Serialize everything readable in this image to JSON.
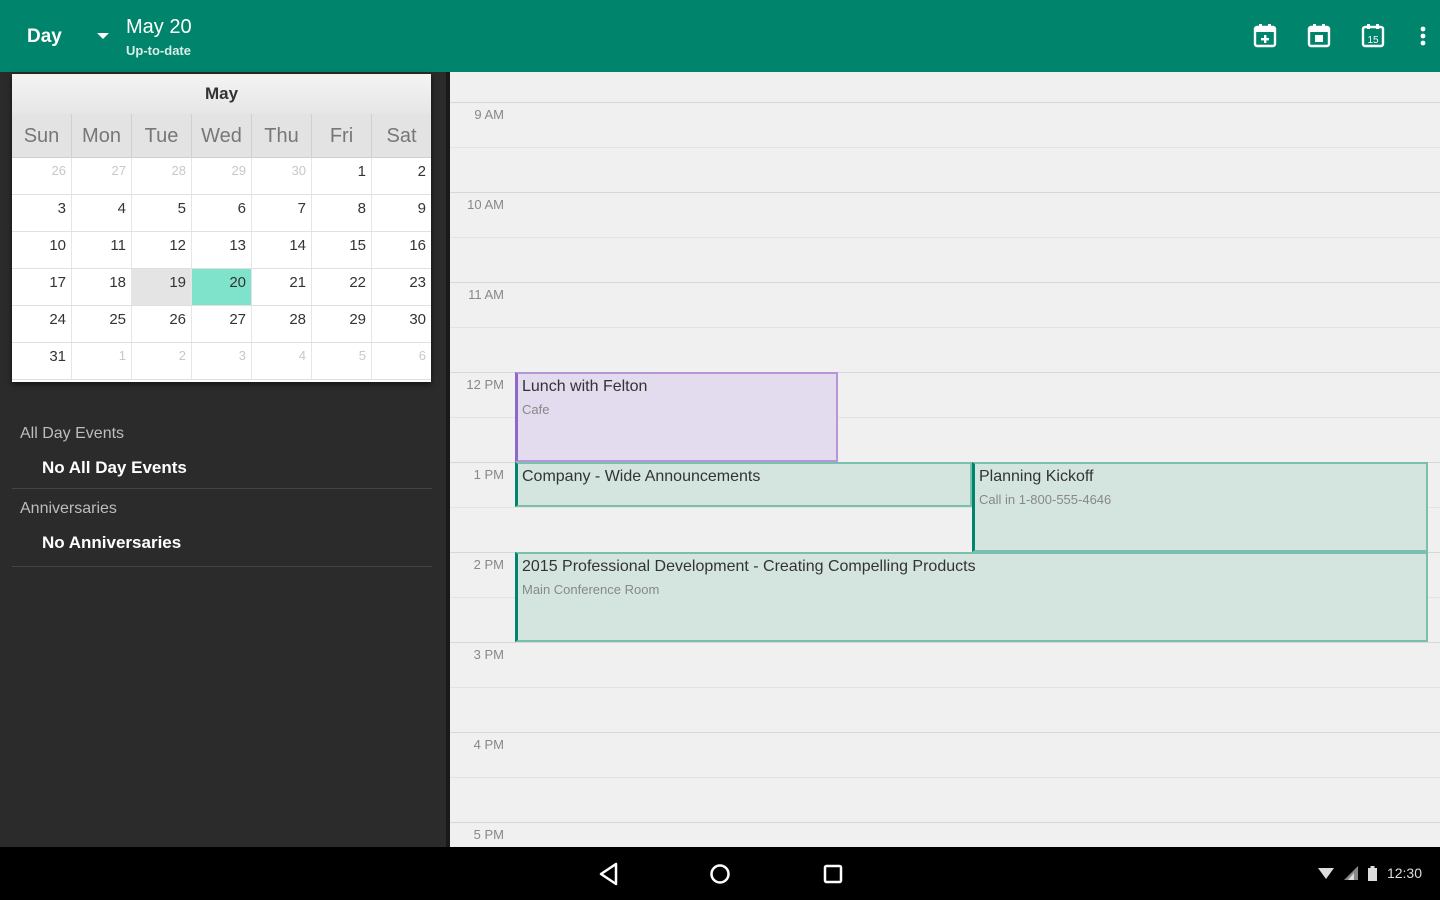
{
  "topbar": {
    "view_label": "Day",
    "date_title": "May 20",
    "date_subtitle": "Up-to-date",
    "actions": [
      "go-to-today-icon",
      "new-event-icon",
      "calendar-view-icon",
      "overflow-menu-icon"
    ]
  },
  "mini_calendar": {
    "month": "May",
    "weekdays": [
      "Sun",
      "Mon",
      "Tue",
      "Wed",
      "Thu",
      "Fri",
      "Sat"
    ],
    "weeks": [
      [
        "26",
        "27",
        "28",
        "29",
        "30",
        "1",
        "2"
      ],
      [
        "3",
        "4",
        "5",
        "6",
        "7",
        "8",
        "9"
      ],
      [
        "10",
        "11",
        "12",
        "13",
        "14",
        "15",
        "16"
      ],
      [
        "17",
        "18",
        "19",
        "20",
        "21",
        "22",
        "23"
      ],
      [
        "24",
        "25",
        "26",
        "27",
        "28",
        "29",
        "30"
      ],
      [
        "31",
        "1",
        "2",
        "3",
        "4",
        "5",
        "6"
      ]
    ],
    "today": "19",
    "selected": "20"
  },
  "sections": {
    "all_day_header": "All Day Events",
    "all_day_value": "No All Day Events",
    "anniversaries_header": "Anniversaries",
    "anniversaries_value": "No Anniversaries"
  },
  "day_view": {
    "hours": [
      "9 AM",
      "10 AM",
      "11 AM",
      "12 PM",
      "1 PM",
      "2 PM",
      "3 PM",
      "4 PM",
      "5 PM"
    ],
    "events": [
      {
        "title": "Lunch with Felton",
        "location": "Cafe",
        "start": "12 PM",
        "end": "1 PM",
        "color": "#8f67c4"
      },
      {
        "title": "Company - Wide Announcements",
        "location": "",
        "start": "1 PM",
        "end": "1:30 PM",
        "color": "#00846c"
      },
      {
        "title": "Planning Kickoff",
        "location": "Call in 1-800-555-4646",
        "start": "1 PM",
        "end": "2 PM",
        "color": "#00846c"
      },
      {
        "title": "2015 Professional Development - Creating Compelling Products",
        "location": "Main Conference Room",
        "start": "2 PM",
        "end": "3 PM",
        "color": "#00846c"
      }
    ]
  },
  "status_bar": {
    "time": "12:30"
  },
  "colors": {
    "accent": "#00846c",
    "event_green": "#d4e5e0",
    "event_purple": "#e3dbee"
  }
}
